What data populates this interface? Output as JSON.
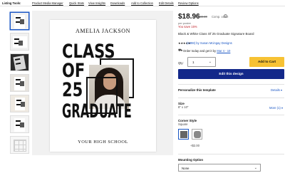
{
  "topnav": {
    "lead": "Listing Tools:",
    "links": [
      "Product Media Manager",
      "Quick Stats",
      "View Insights",
      "Downloads",
      "Add to Collection",
      "Edit Details",
      "Review Options"
    ]
  },
  "preview": {
    "name": "AMELIA JACKSON",
    "lines": [
      "CLASS",
      "OF",
      "25",
      "GRADUATE"
    ],
    "school": "YOUR HIGH SCHOOL"
  },
  "product": {
    "price": "$18.96",
    "old_price": "$22.30",
    "qty_price": "Comp. value",
    "info_icon": "i",
    "per_label": "per poster",
    "save_text": "You save 15%",
    "title": "Black & White Class Of 25 Graduate Signature Board",
    "stars": "★★★★★",
    "reviews": "(1398) by Susan Mcingay Designs",
    "delivery_text": "Order today and get it by",
    "delivery_date": "Mar 4 - 10",
    "qty_label": "Qty:",
    "qty_value": "1",
    "add_to_cart": "Add to Cart",
    "edit_design": "Edit this design"
  },
  "options": {
    "personalize_label": "Personalize this template",
    "details_link": "Details ▾",
    "size_label": "Size",
    "size_value": "8\" x 10\"",
    "more_info": "More (1) ▾",
    "corner_label": "Corner Style",
    "corner_value": "Square",
    "rounded_price": "+$2.00",
    "mounting_label": "Mounting Option",
    "mounting_value": "None"
  }
}
